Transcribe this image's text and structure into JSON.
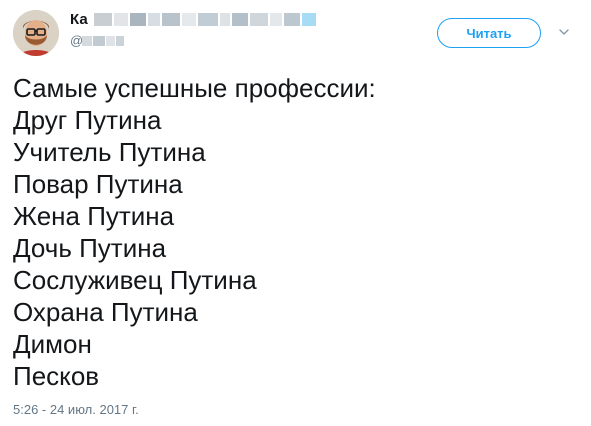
{
  "author": {
    "display_name_visible": "Ка",
    "handle_visible": "@",
    "avatar": "avatar-man-with-glasses-and-beard"
  },
  "follow_button": {
    "label": "Читать"
  },
  "menu": {
    "icon": "chevron-down-icon"
  },
  "tweet": {
    "lines": [
      "Самые успешные профессии:",
      "Друг Путина",
      "Учитель Путина",
      "Повар Путина",
      "Жена Путина",
      "Дочь Путина",
      "Сослуживец Путина",
      "Охрана Путина",
      "Димон",
      "Песков"
    ],
    "timestamp": "5:26 - 24 июл. 2017 г."
  },
  "colors": {
    "accent": "#1da1f2",
    "text": "#14171a",
    "muted": "#657786"
  }
}
